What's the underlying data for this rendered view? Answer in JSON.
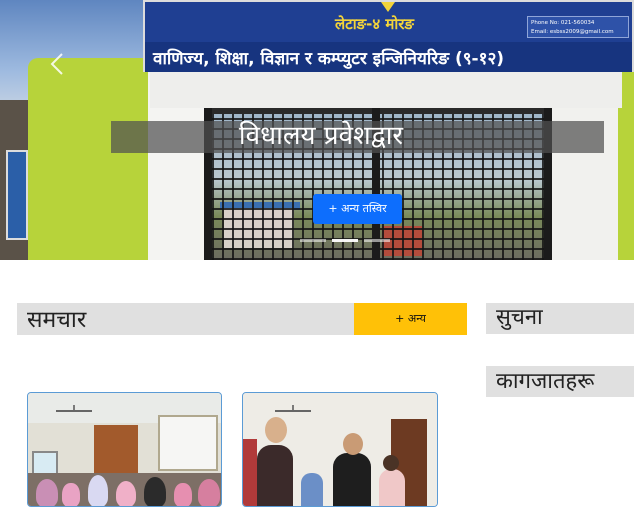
{
  "hero": {
    "signboard": {
      "line1": "लेटाङ-४ मोरङ",
      "line2": "वाणिज्य, शिक्षा, विज्ञान र कम्प्युटर इन्जिनियरिङ (९-१२)",
      "phone": "Phone No: 021-560034",
      "email": "Email: esbss2009@gmail.com"
    },
    "prev_icon": "chevron-left-icon",
    "caption": "विधालय प्रवेशद्वार",
    "more_photos_label": "+ अन्य तस्विर",
    "indicator_count": 3,
    "active_indicator": 1
  },
  "news": {
    "title": "समचार",
    "more_label": "+ अन्य"
  },
  "sidebar": {
    "notice_title": "सुचना",
    "documents_title": "कागजातहरू"
  },
  "colors": {
    "primary_button": "#0d6efd",
    "accent_button": "#ffc107",
    "section_header_bg": "#e0e0e0",
    "card_border": "#5b9bd5",
    "signboard": "#1f3f92",
    "sign_text": "#f3d43a"
  }
}
